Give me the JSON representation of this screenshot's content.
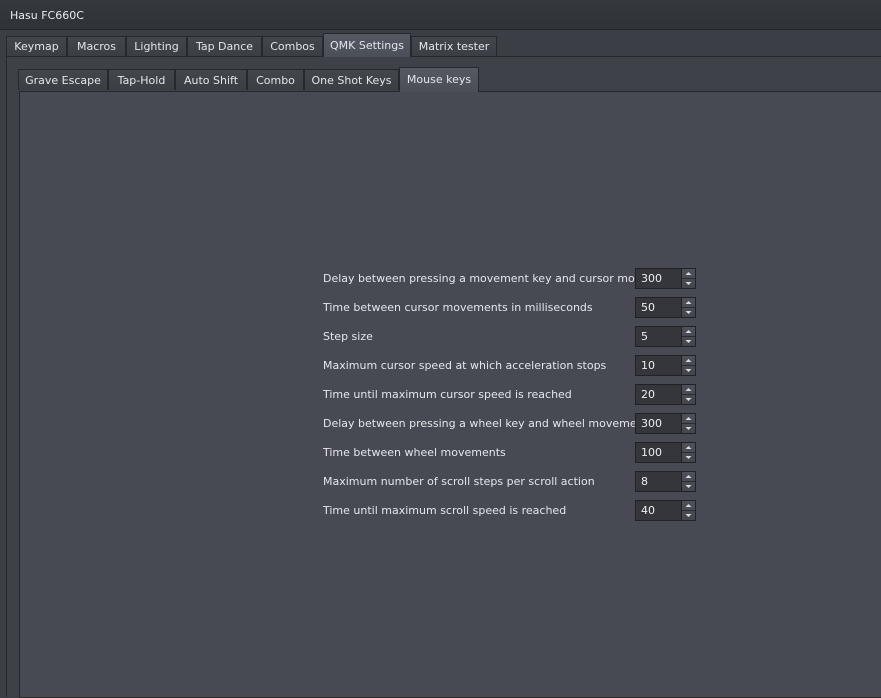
{
  "window": {
    "title": "Hasu FC660C"
  },
  "tabs": [
    {
      "label": "Keymap"
    },
    {
      "label": "Macros"
    },
    {
      "label": "Lighting"
    },
    {
      "label": "Tap Dance"
    },
    {
      "label": "Combos"
    },
    {
      "label": "QMK Settings"
    },
    {
      "label": "Matrix tester"
    }
  ],
  "active_tab": "QMK Settings",
  "subtabs": [
    {
      "label": "Grave Escape"
    },
    {
      "label": "Tap-Hold"
    },
    {
      "label": "Auto Shift"
    },
    {
      "label": "Combo"
    },
    {
      "label": "One Shot Keys"
    },
    {
      "label": "Mouse keys"
    }
  ],
  "active_subtab": "Mouse keys",
  "settings": [
    {
      "label": "Delay between pressing a movement key and cursor movement",
      "value": "300"
    },
    {
      "label": "Time between cursor movements in milliseconds",
      "value": "50"
    },
    {
      "label": "Step size",
      "value": "5"
    },
    {
      "label": "Maximum cursor speed at which acceleration stops",
      "value": "10"
    },
    {
      "label": "Time until maximum cursor speed is reached",
      "value": "20"
    },
    {
      "label": "Delay between pressing a wheel key and wheel movement",
      "value": "300"
    },
    {
      "label": "Time between wheel movements",
      "value": "100"
    },
    {
      "label": "Maximum number of scroll steps per scroll action",
      "value": "8"
    },
    {
      "label": "Time until maximum scroll speed is reached",
      "value": "40"
    }
  ]
}
